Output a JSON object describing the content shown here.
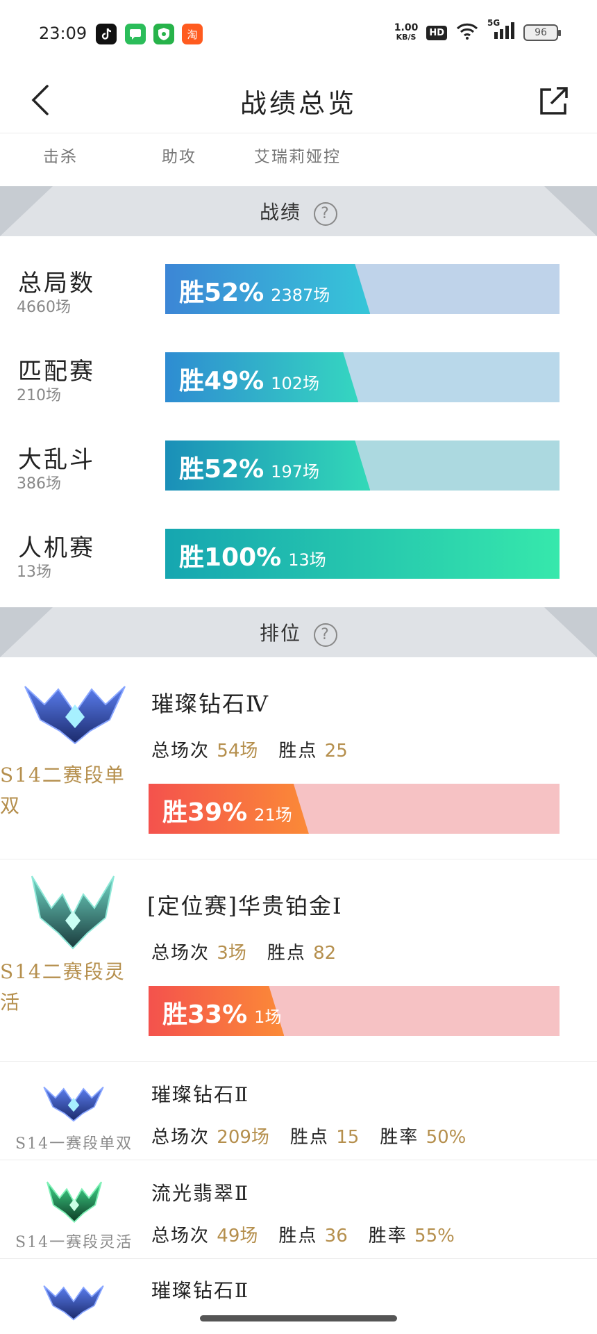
{
  "status_bar": {
    "time": "23:09",
    "net_speed_value": "1.00",
    "net_speed_unit": "KB/S",
    "hd_badge": "HD",
    "network": "5G",
    "battery": "96",
    "app_icons": [
      "tiktok-icon",
      "messages-icon",
      "shield-icon",
      "taobao-icon"
    ]
  },
  "header": {
    "title": "战绩总览",
    "back_icon": "chevron-left-icon",
    "share_icon": "share-external-icon"
  },
  "subtabs": [
    "击杀",
    "助攻",
    "艾瑞莉娅控"
  ],
  "sections": {
    "stats_title": "战绩",
    "ranked_title": "排位",
    "help_glyph": "?"
  },
  "stats": [
    {
      "name": "总局数",
      "count": "4660场",
      "win_label": "胜52%",
      "wins": "2387场",
      "win_rate": 0.52
    },
    {
      "name": "匹配赛",
      "count": "210场",
      "win_label": "胜49%",
      "wins": "102场",
      "win_rate": 0.49
    },
    {
      "name": "大乱斗",
      "count": "386场",
      "win_label": "胜52%",
      "wins": "197场",
      "win_rate": 0.52
    },
    {
      "name": "人机赛",
      "count": "13场",
      "win_label": "胜100%",
      "wins": "13场",
      "win_rate": 1.0
    }
  ],
  "ranked": [
    {
      "season": "S14二赛段单双",
      "tier": "璀璨钻石Ⅳ",
      "total_label": "总场次",
      "total": "54场",
      "points_label": "胜点",
      "points": "25",
      "win_label": "胜39%",
      "wins": "21场",
      "win_rate": 0.39,
      "emblem": "diamond-emblem-icon"
    },
    {
      "season": "S14二赛段灵活",
      "tier": "[定位赛]华贵铂金Ⅰ",
      "total_label": "总场次",
      "total": "3场",
      "points_label": "胜点",
      "points": "82",
      "win_label": "胜33%",
      "wins": "1场",
      "win_rate": 0.33,
      "emblem": "platinum-emblem-icon"
    },
    {
      "season": "S14一赛段单双",
      "tier": "璀璨钻石Ⅱ",
      "total_label": "总场次",
      "total": "209场",
      "points_label": "胜点",
      "points": "15",
      "rate_label": "胜率",
      "rate": "50%",
      "emblem": "diamond-emblem-icon"
    },
    {
      "season": "S14一赛段灵活",
      "tier": "流光翡翠Ⅱ",
      "total_label": "总场次",
      "total": "49场",
      "points_label": "胜点",
      "points": "36",
      "rate_label": "胜率",
      "rate": "55%",
      "emblem": "emerald-emblem-icon"
    },
    {
      "tier": "璀璨钻石Ⅱ",
      "emblem": "diamond-emblem-icon"
    }
  ],
  "colors": {
    "gold": "#b58f4d",
    "section_bg": "#dfe2e6",
    "loss_pink": "#f6c2c4",
    "win_orange": "#f4524d"
  }
}
